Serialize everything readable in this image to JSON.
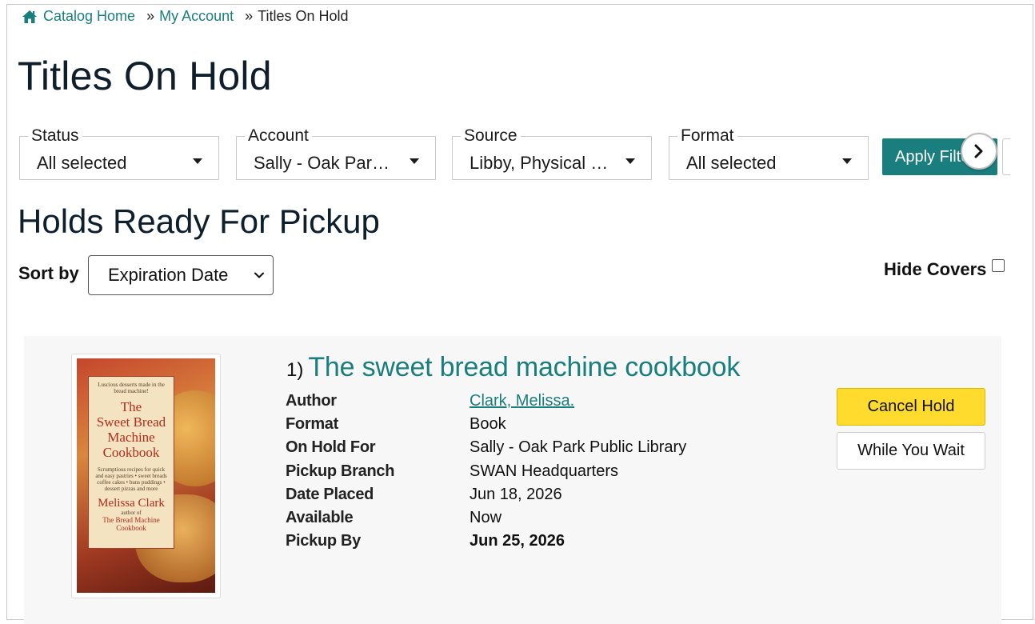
{
  "breadcrumb": {
    "home_label": "Catalog Home",
    "sep1": "»",
    "account_label": "My Account",
    "sep2": "»",
    "current_label": "Titles On Hold"
  },
  "page_title": "Titles On Hold",
  "filters": {
    "status": {
      "label": "Status",
      "value": "All selected"
    },
    "account": {
      "label": "Account",
      "value": "Sally - Oak Park Public Library"
    },
    "source": {
      "label": "Source",
      "value": "Libby, Physical Materials"
    },
    "format": {
      "label": "Format",
      "value": "All selected"
    },
    "apply_label": "Apply Filters"
  },
  "section_title": "Holds Ready For Pickup",
  "sort": {
    "label": "Sort by",
    "selected": "Expiration Date"
  },
  "hide_covers_label": "Hide Covers",
  "holds": [
    {
      "number": "1)",
      "title": "The sweet bread machine cookbook",
      "cover": {
        "tagline": "Luscious desserts made in the bread machine!",
        "title_line1": "The",
        "title_line2": "Sweet Bread",
        "title_line3": "Machine",
        "title_line4": "Cookbook",
        "blurb": "Scrumptious recipes for quick and easy pastries • sweet breads coffee cakes • buns puddings • dessert pizzas and more",
        "author": "Melissa Clark",
        "author_of": "author of",
        "other_book": "The Bread Machine Cookbook"
      },
      "details": [
        {
          "label": "Author",
          "value": "Clark, Melissa.",
          "link": true
        },
        {
          "label": "Format",
          "value": "Book"
        },
        {
          "label": "On Hold For",
          "value": "Sally - Oak Park Public Library"
        },
        {
          "label": "Pickup Branch",
          "value": "SWAN Headquarters"
        },
        {
          "label": "Date Placed",
          "value": "Jun 18, 2026"
        },
        {
          "label": "Available",
          "value": "Now"
        },
        {
          "label": "Pickup By",
          "value": "Jun 25, 2026",
          "bold": true
        }
      ],
      "cancel_label": "Cancel Hold",
      "wait_label": "While You Wait"
    }
  ],
  "colors": {
    "accent": "#1b7e7e",
    "cancel": "#fedb2c",
    "heading": "#0e1e2b",
    "card_bg": "#f7f7f7"
  },
  "icons": {
    "home": "home-icon",
    "caret": "caret-down-icon",
    "scroll": "chevron-right-icon",
    "sort": "chevron-down-icon"
  }
}
